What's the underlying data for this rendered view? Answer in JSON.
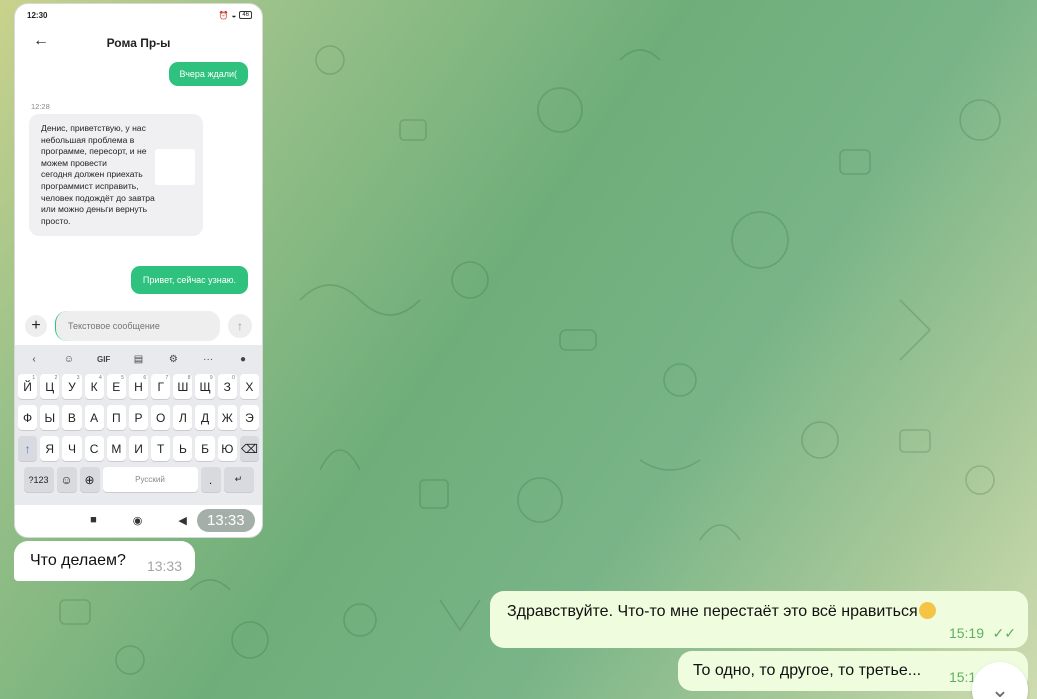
{
  "phone": {
    "status_time": "12:30",
    "status_icons": [
      "sim-icon",
      "mail-icon",
      "alarm-icon",
      "wifi-icon",
      "battery-icon"
    ],
    "battery": "46",
    "contact_name": "Рома Пр-ы",
    "messages": {
      "out_top": "Вчера ждали(",
      "time_label": "12:28",
      "incoming": "Денис, приветствую, у нас\nнебольшая проблема в\nпрограмме, пересорт, и не\nможем провести\nсегодня должен приехать\nпрограммист исправить,\nчеловек подождёт до завтра\nили можно деньги вернуть\nпросто.",
      "out_reply": "Привет, сейчас узнаю."
    },
    "input_placeholder": "Текстовое сообщение",
    "keyboard": {
      "toolbar_gif": "GIF",
      "row1": [
        "Й",
        "Ц",
        "У",
        "К",
        "Е",
        "Н",
        "Г",
        "Ш",
        "Щ",
        "З",
        "Х"
      ],
      "row1_hints": [
        "1",
        "2",
        "3",
        "4",
        "5",
        "6",
        "7",
        "8",
        "9",
        "0",
        ""
      ],
      "row2": [
        "Ф",
        "Ы",
        "В",
        "А",
        "П",
        "Р",
        "О",
        "Л",
        "Д",
        "Ж",
        "Э"
      ],
      "row3": [
        "Я",
        "Ч",
        "С",
        "М",
        "И",
        "Т",
        "Ь",
        "Б",
        "Ю"
      ],
      "sym_key": "?123",
      "space_label": "Русский",
      "period": "."
    },
    "overlay_time": "13:33"
  },
  "chat": {
    "incoming_text": "Что делаем?",
    "incoming_time": "13:33",
    "outgoing1_text": "Здравствуйте. Что-то мне перестаёт это всё нравиться",
    "outgoing1_time": "15:19",
    "outgoing2_text": "То одно, то другое, то третье...",
    "outgoing2_time": "15:19"
  },
  "colors": {
    "phone_bubble_green": "#2ec27e",
    "telegram_out_bubble": "#effdde",
    "read_check": "#5fae63"
  }
}
